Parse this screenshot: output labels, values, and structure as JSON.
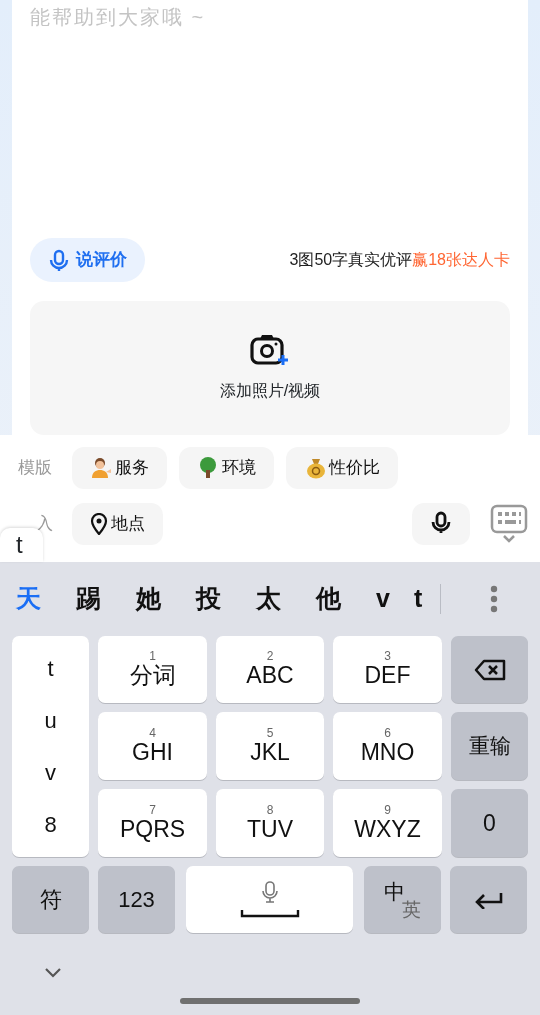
{
  "review": {
    "placeholder": "能帮助到大家哦 ~",
    "voice_button": "说评价",
    "promo_text": "3图50字真实优评",
    "promo_highlight": "赢18张达人卡",
    "upload_label": "添加照片/视频"
  },
  "templates": {
    "label": "模版",
    "chips": [
      {
        "label": "服务"
      },
      {
        "label": "环境"
      },
      {
        "label": "性价比"
      }
    ]
  },
  "insert": {
    "label": "入",
    "chips": [
      {
        "label": "地点"
      }
    ]
  },
  "key_popup": "t",
  "candidates": [
    {
      "text": "天",
      "selected": true
    },
    {
      "text": "踢",
      "selected": false
    },
    {
      "text": "她",
      "selected": false
    },
    {
      "text": "投",
      "selected": false
    },
    {
      "text": "太",
      "selected": false
    },
    {
      "text": "他",
      "selected": false
    },
    {
      "text": "v",
      "selected": false
    },
    {
      "text": "t",
      "selected": false
    }
  ],
  "pinyin_column": [
    "t",
    "u",
    "v",
    "8"
  ],
  "keys": [
    {
      "number": "1",
      "label": "分词"
    },
    {
      "number": "2",
      "label": "ABC"
    },
    {
      "number": "3",
      "label": "DEF"
    },
    {
      "number": "4",
      "label": "GHI"
    },
    {
      "number": "5",
      "label": "JKL"
    },
    {
      "number": "6",
      "label": "MNO"
    },
    {
      "number": "7",
      "label": "PQRS"
    },
    {
      "number": "8",
      "label": "TUV"
    },
    {
      "number": "9",
      "label": "WXYZ"
    }
  ],
  "side_keys": {
    "reset": "重输",
    "zero": "0"
  },
  "bottom_keys": {
    "symbols": "符",
    "numbers": "123",
    "lang_primary": "中",
    "lang_secondary": "英"
  }
}
